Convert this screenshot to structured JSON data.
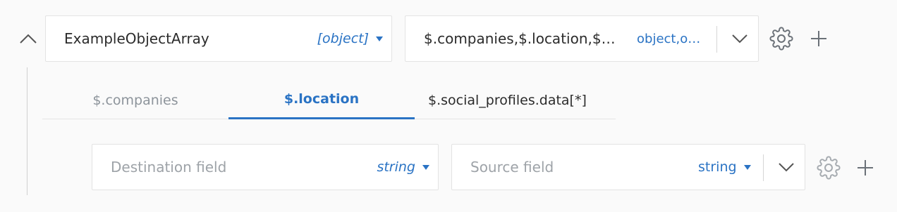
{
  "mapping": {
    "destination_name": "ExampleObjectArray",
    "destination_type": "[object]",
    "source_value": "$.companies,$.location,$…",
    "source_type": "object,o…"
  },
  "tabs": [
    {
      "label": "$.companies",
      "state": "inactive"
    },
    {
      "label": "$.location",
      "state": "active"
    },
    {
      "label": "$.social_profiles.data[*]",
      "state": "inactive"
    }
  ],
  "child_row": {
    "destination_placeholder": "Destination field",
    "destination_type": "string",
    "source_placeholder": "Source field",
    "source_type": "string"
  },
  "colors": {
    "accent": "#2a73c4",
    "icon_dark": "#6b7178",
    "icon_light": "#a6abb0"
  }
}
